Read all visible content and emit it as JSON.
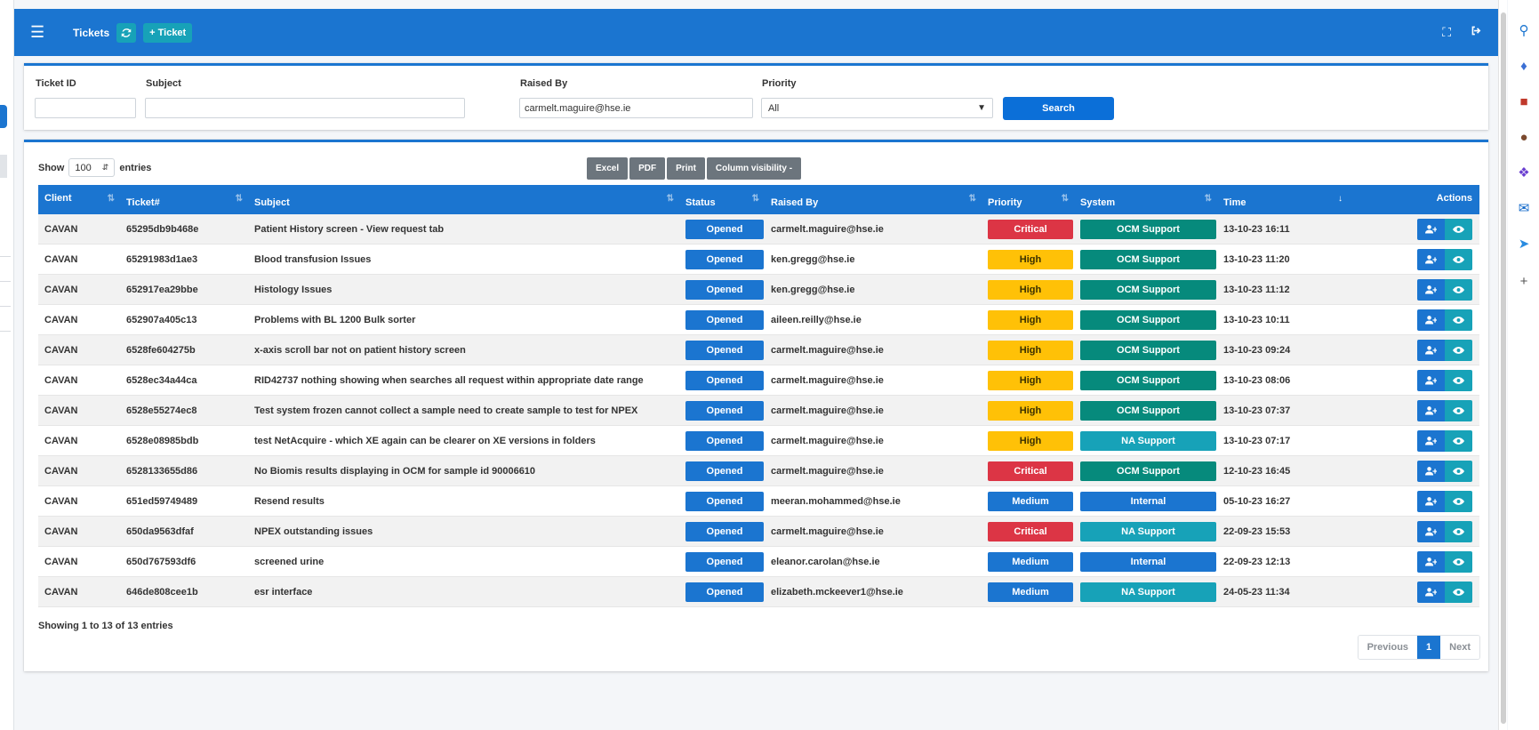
{
  "navbar": {
    "title": "Tickets",
    "add_ticket_label": "+ Ticket"
  },
  "filters": {
    "ticket_id_label": "Ticket ID",
    "ticket_id_value": "",
    "subject_label": "Subject",
    "subject_value": "",
    "raised_by_label": "Raised By",
    "raised_by_value": "carmelt.maguire@hse.ie",
    "priority_label": "Priority",
    "priority_value": "All",
    "search_label": "Search"
  },
  "table_controls": {
    "show_label": "Show",
    "length_value": "100",
    "entries_label": "entries",
    "export_buttons": [
      "Excel",
      "PDF",
      "Print",
      "Column visibility -"
    ]
  },
  "columns": {
    "client": "Client",
    "ticket": "Ticket#",
    "subject": "Subject",
    "status": "Status",
    "raised_by": "Raised By",
    "priority": "Priority",
    "system": "System",
    "time": "Time",
    "actions": "Actions"
  },
  "colors": {
    "primary": "#1b75d0",
    "critical": "#dc3545",
    "high": "#ffc107",
    "medium": "#1b75d0",
    "ocm_support": "#068a7c",
    "na_support": "#17a2b8",
    "internal": "#1b75d0"
  },
  "rows": [
    {
      "client": "CAVAN",
      "ticket": "65295db9b468e",
      "subject": "Patient History screen - View request tab",
      "status": "Opened",
      "raised_by": "carmelt.maguire@hse.ie",
      "priority": "Critical",
      "system": "OCM Support",
      "time": "13-10-23 16:11"
    },
    {
      "client": "CAVAN",
      "ticket": "65291983d1ae3",
      "subject": "Blood transfusion Issues",
      "status": "Opened",
      "raised_by": "ken.gregg@hse.ie",
      "priority": "High",
      "system": "OCM Support",
      "time": "13-10-23 11:20"
    },
    {
      "client": "CAVAN",
      "ticket": "652917ea29bbe",
      "subject": "Histology Issues",
      "status": "Opened",
      "raised_by": "ken.gregg@hse.ie",
      "priority": "High",
      "system": "OCM Support",
      "time": "13-10-23 11:12"
    },
    {
      "client": "CAVAN",
      "ticket": "652907a405c13",
      "subject": "Problems with BL 1200 Bulk sorter",
      "status": "Opened",
      "raised_by": "aileen.reilly@hse.ie",
      "priority": "High",
      "system": "OCM Support",
      "time": "13-10-23 10:11"
    },
    {
      "client": "CAVAN",
      "ticket": "6528fe604275b",
      "subject": "x-axis scroll bar not on patient history screen",
      "status": "Opened",
      "raised_by": "carmelt.maguire@hse.ie",
      "priority": "High",
      "system": "OCM Support",
      "time": "13-10-23 09:24"
    },
    {
      "client": "CAVAN",
      "ticket": "6528ec34a44ca",
      "subject": "RID42737 nothing showing when searches all request within appropriate date range",
      "status": "Opened",
      "raised_by": "carmelt.maguire@hse.ie",
      "priority": "High",
      "system": "OCM Support",
      "time": "13-10-23 08:06"
    },
    {
      "client": "CAVAN",
      "ticket": "6528e55274ec8",
      "subject": "Test system frozen cannot collect a sample need to create sample to test for NPEX",
      "status": "Opened",
      "raised_by": "carmelt.maguire@hse.ie",
      "priority": "High",
      "system": "OCM Support",
      "time": "13-10-23 07:37"
    },
    {
      "client": "CAVAN",
      "ticket": "6528e08985bdb",
      "subject": "test NetAcquire - which XE again can be clearer on XE versions in folders",
      "status": "Opened",
      "raised_by": "carmelt.maguire@hse.ie",
      "priority": "High",
      "system": "NA Support",
      "time": "13-10-23 07:17"
    },
    {
      "client": "CAVAN",
      "ticket": "6528133655d86",
      "subject": "No Biomis results displaying in OCM for sample id 90006610",
      "status": "Opened",
      "raised_by": "carmelt.maguire@hse.ie",
      "priority": "Critical",
      "system": "OCM Support",
      "time": "12-10-23 16:45"
    },
    {
      "client": "CAVAN",
      "ticket": "651ed59749489",
      "subject": "Resend results",
      "status": "Opened",
      "raised_by": "meeran.mohammed@hse.ie",
      "priority": "Medium",
      "system": "Internal",
      "time": "05-10-23 16:27"
    },
    {
      "client": "CAVAN",
      "ticket": "650da9563dfaf",
      "subject": "NPEX outstanding issues",
      "status": "Opened",
      "raised_by": "carmelt.maguire@hse.ie",
      "priority": "Critical",
      "system": "NA Support",
      "time": "22-09-23 15:53"
    },
    {
      "client": "CAVAN",
      "ticket": "650d767593df6",
      "subject": "screened urine",
      "status": "Opened",
      "raised_by": "eleanor.carolan@hse.ie",
      "priority": "Medium",
      "system": "Internal",
      "time": "22-09-23 12:13"
    },
    {
      "client": "CAVAN",
      "ticket": "646de808cee1b",
      "subject": "esr interface",
      "status": "Opened",
      "raised_by": "elizabeth.mckeever1@hse.ie",
      "priority": "Medium",
      "system": "NA Support",
      "time": "24-05-23 11:34"
    }
  ],
  "footer": {
    "info": "Showing 1 to 13 of 13 entries",
    "previous_label": "Previous",
    "current_page": "1",
    "next_label": "Next"
  }
}
